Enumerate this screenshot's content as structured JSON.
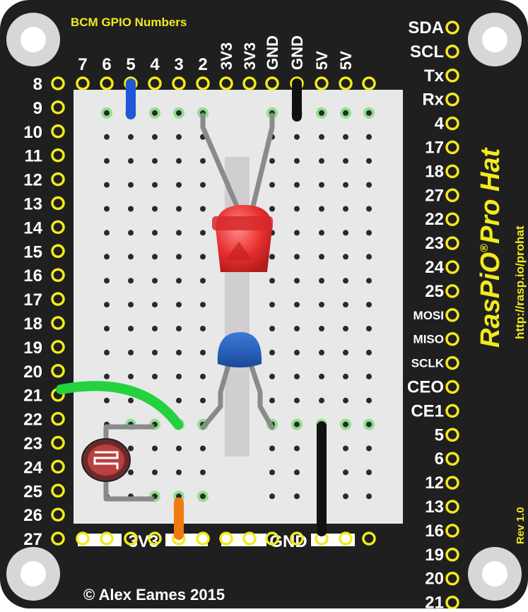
{
  "header": {
    "title": "BCM GPIO Numbers"
  },
  "top_labels": [
    "7",
    "6",
    "5",
    "4",
    "3",
    "2",
    "3V3",
    "3V3",
    "GND",
    "GND",
    "5V",
    "5V"
  ],
  "left_labels": [
    "8",
    "9",
    "10",
    "11",
    "12",
    "13",
    "14",
    "15",
    "16",
    "17",
    "18",
    "19",
    "20",
    "21",
    "22",
    "23",
    "24",
    "25",
    "26",
    "27"
  ],
  "right_labels": [
    "SDA",
    "SCL",
    "Tx",
    "Rx",
    "4",
    "17",
    "18",
    "27",
    "22",
    "23",
    "24",
    "25",
    "MOSI",
    "MISO",
    "SCLK",
    "CEO",
    "CE1",
    "5",
    "6",
    "12",
    "13",
    "16",
    "19",
    "20",
    "21"
  ],
  "bottom_rail_labels": {
    "left": "3V3",
    "right": "GND"
  },
  "brand": {
    "name": "RasPiO",
    "registered": "®",
    "product": "Pro Hat",
    "url": "http://rasp.io/prohat",
    "revision": "Rev 1.0"
  },
  "footer": {
    "copyright": "© Alex Eames 2015"
  },
  "colors": {
    "board": "#1f1f1f",
    "pin_ring": "#f2ea1c",
    "label_text": "#ffffff",
    "title_text": "#f2ea1c",
    "breadboard": "#e8e8e8",
    "hole_highlight": "#8fe08f",
    "wire_blue": "#1f57d6",
    "wire_black": "#111111",
    "wire_green": "#23d23c",
    "wire_orange": "#f07a10",
    "led_red": "#e83030",
    "capacitor_blue": "#2060b8"
  },
  "components": [
    "led-red",
    "ceramic-capacitor",
    "photoresistor"
  ]
}
